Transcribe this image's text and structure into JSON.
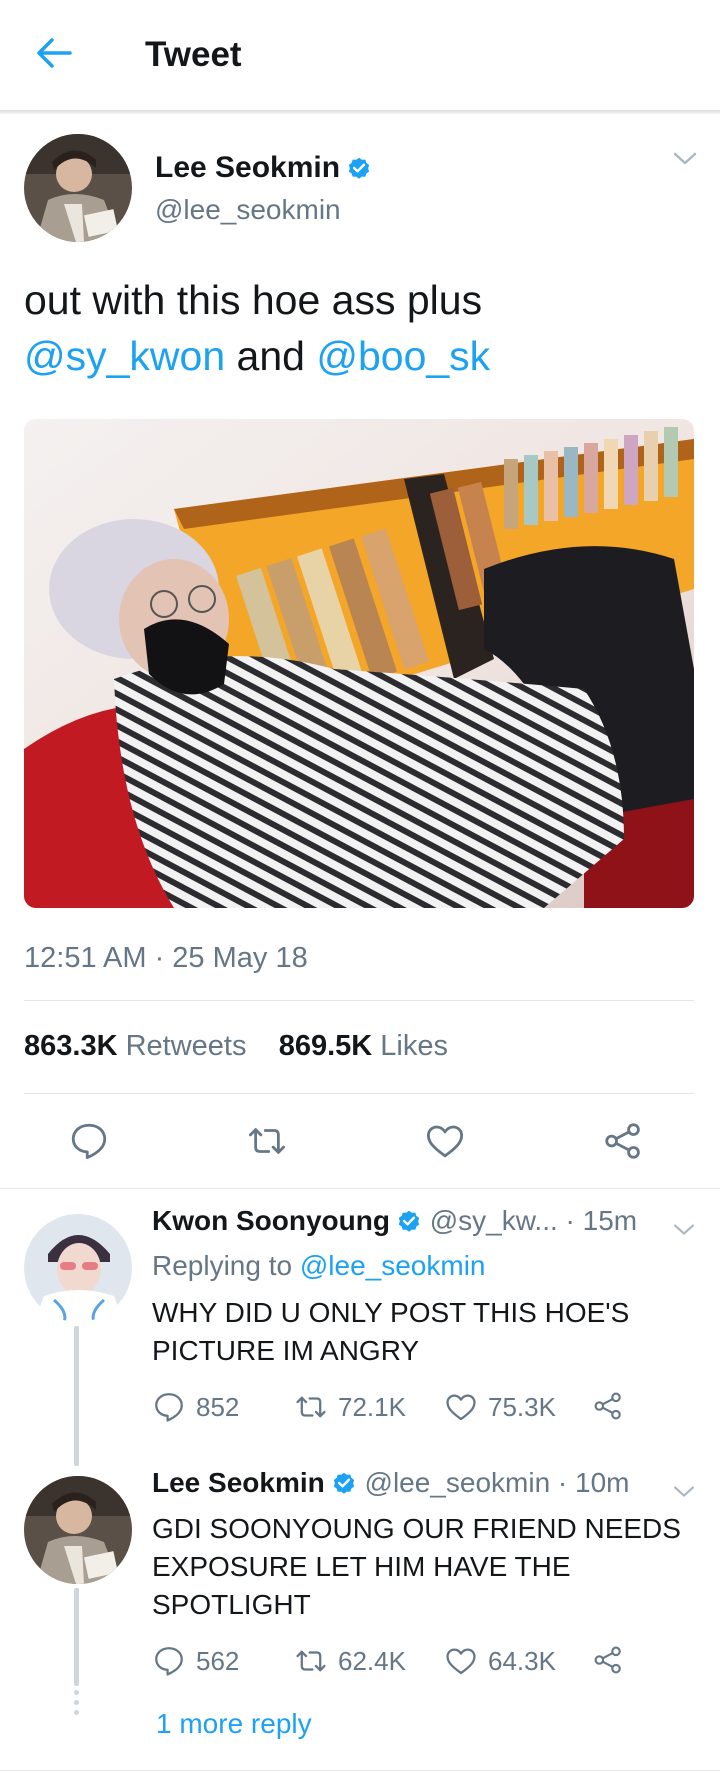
{
  "header": {
    "title": "Tweet"
  },
  "tweet": {
    "author_name": "Lee Seokmin",
    "author_handle": "@lee_seokmin",
    "text_plain_1": "out with this hoe ass plus",
    "mention_1": "@sy_kwon",
    "text_plain_2": " and ",
    "mention_2": "@boo_sk",
    "timestamp": "12:51 AM · 25 May 18",
    "retweets_count": "863.3K",
    "retweets_label": " Retweets",
    "likes_count": "869.5K",
    "likes_label": " Likes"
  },
  "replies": [
    {
      "author_name": "Kwon Soonyoung",
      "author_handle": "@sy_kw...",
      "time": " · 15m",
      "replying_prefix": "Replying to ",
      "replying_to": "@lee_seokmin",
      "text_line_1": "WHY DID U ONLY POST THIS HOE'S",
      "text_line_2": "PICTURE IM ANGRY",
      "replies_count": "852",
      "retweets_count": "72.1K",
      "likes_count": "75.3K"
    },
    {
      "author_name": "Lee Seokmin",
      "author_handle": "@lee_seokmin",
      "time": " · 10m",
      "text_line_1": "GDI SOONYOUNG OUR FRIEND NEEDS",
      "text_line_2": "EXPOSURE LET HIM HAVE THE",
      "text_line_3": "SPOTLIGHT",
      "replies_count": "562",
      "retweets_count": "62.4K",
      "likes_count": "64.3K"
    }
  ],
  "more_replies_label": "1 more reply",
  "colors": {
    "accent": "#1da1f2",
    "text": "#14171a",
    "muted": "#657786",
    "divider": "#e1e8ed"
  }
}
